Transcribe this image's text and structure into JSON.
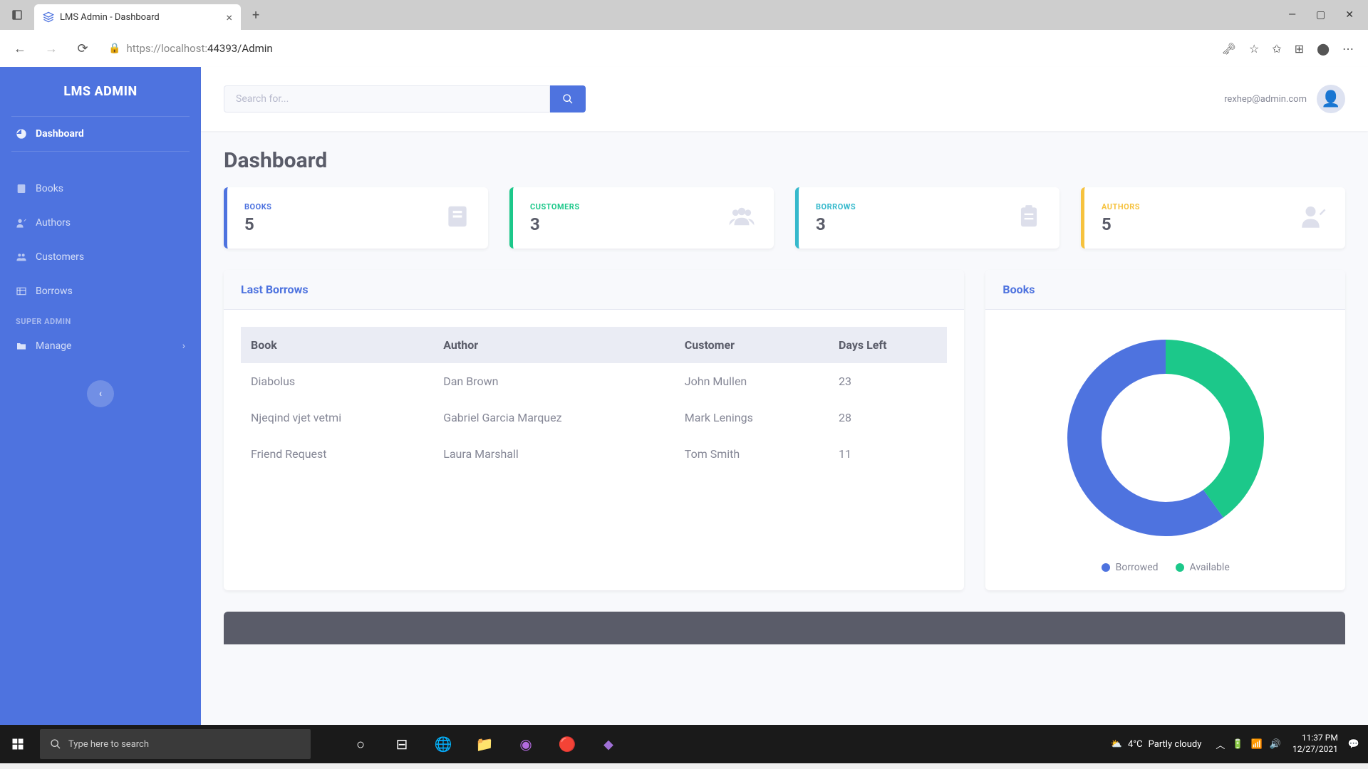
{
  "browser": {
    "tab_title": "LMS Admin - Dashboard",
    "url_display": "https://localhost:44393/Admin",
    "url_host": "localhost:",
    "url_prefix": "https://",
    "url_port_path": "44393/Admin"
  },
  "sidebar": {
    "brand": "LMS ADMIN",
    "items": [
      {
        "label": "Dashboard",
        "active": true
      },
      {
        "label": "Books"
      },
      {
        "label": "Authors"
      },
      {
        "label": "Customers"
      },
      {
        "label": "Borrows"
      }
    ],
    "heading": "SUPER ADMIN",
    "manage_label": "Manage"
  },
  "topbar": {
    "search_placeholder": "Search for...",
    "user_email": "rexhep@admin.com"
  },
  "page": {
    "title": "Dashboard"
  },
  "stats": [
    {
      "label": "BOOKS",
      "value": "5"
    },
    {
      "label": "CUSTOMERS",
      "value": "3"
    },
    {
      "label": "BORROWS",
      "value": "3"
    },
    {
      "label": "AUTHORS",
      "value": "5"
    }
  ],
  "borrows_panel": {
    "title": "Last Borrows",
    "columns": [
      "Book",
      "Author",
      "Customer",
      "Days Left"
    ],
    "rows": [
      {
        "book": "Diabolus",
        "author": "Dan Brown",
        "customer": "John Mullen",
        "days": "23"
      },
      {
        "book": "Njeqind vjet vetmi",
        "author": "Gabriel Garcia Marquez",
        "customer": "Mark Lenings",
        "days": "28"
      },
      {
        "book": "Friend Request",
        "author": "Laura Marshall",
        "customer": "Tom Smith",
        "days": "11"
      }
    ]
  },
  "books_panel": {
    "title": "Books",
    "legend": [
      "Borrowed",
      "Available"
    ]
  },
  "chart_data": {
    "type": "pie",
    "title": "Books",
    "series": [
      {
        "name": "Borrowed",
        "value": 3,
        "color": "#4e73df"
      },
      {
        "name": "Available",
        "value": 2,
        "color": "#1cc88a"
      }
    ]
  },
  "taskbar": {
    "search_placeholder": "Type here to search",
    "weather_temp": "4°C",
    "weather_text": "Partly cloudy",
    "time": "11:37 PM",
    "date": "12/27/2021"
  }
}
